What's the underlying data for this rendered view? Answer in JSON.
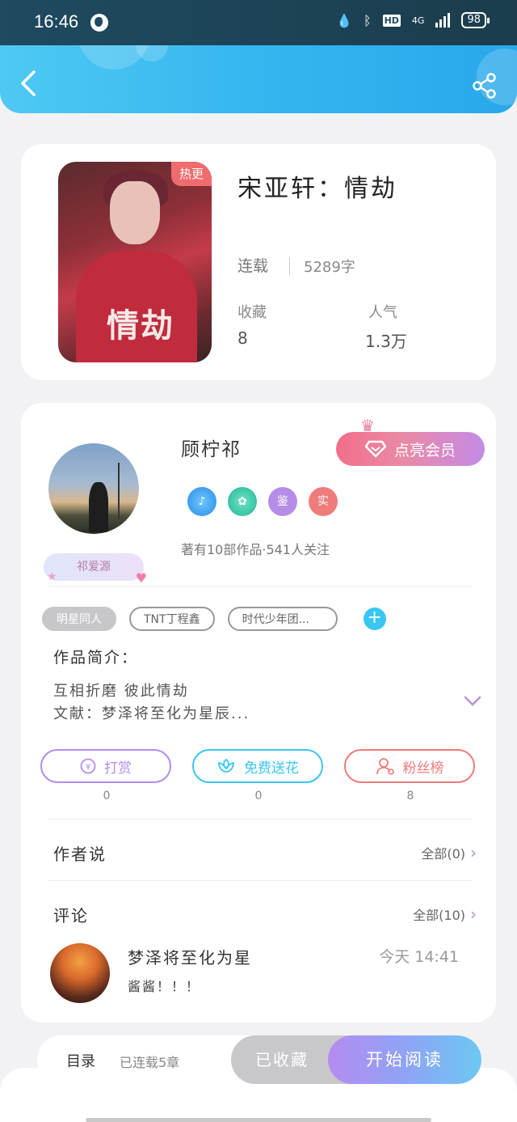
{
  "status_bar": {
    "time": "16:46",
    "hd": "HD",
    "network": "4G",
    "battery": "98"
  },
  "book": {
    "hot_badge": "热更",
    "cover_title": "情劫",
    "title": "宋亚轩：情劫",
    "status": "连载",
    "word_count": "5289字",
    "favorites_label": "收藏",
    "favorites_value": "8",
    "popularity_label": "人气",
    "popularity_value": "1.3万"
  },
  "author": {
    "name": "顾柠祁",
    "fan_tag": "祁爱源",
    "vip_button": "点亮会员",
    "badges": [
      "♪",
      "✿",
      "鉴",
      "实"
    ],
    "works_info": "著有10部作品·541人关注"
  },
  "tags": [
    "明星同人",
    "TNT丁程鑫",
    "时代少年团..."
  ],
  "intro": {
    "title": "作品简介：",
    "line1": "互相折磨 彼此情劫",
    "line2": "文献：梦泽将至化为星辰..."
  },
  "actions": [
    {
      "label": "打赏",
      "count": "0"
    },
    {
      "label": "免费送花",
      "count": "0"
    },
    {
      "label": "粉丝榜",
      "count": "8"
    }
  ],
  "author_says": {
    "title": "作者说",
    "more": "全部(0)"
  },
  "comments": {
    "title": "评论",
    "more": "全部(10)",
    "first": {
      "user": "梦泽将至化为星",
      "time": "今天 14:41",
      "text": "酱酱！！！"
    }
  },
  "bottom_bar": {
    "toc": "目录",
    "chapters": "已连载5章",
    "collected": "已收藏",
    "start_reading": "开始阅读"
  },
  "colors": {
    "header": "#35b6ef",
    "vip": "#f26f8a",
    "reward": "#b48cf0",
    "flower": "#38c6f2",
    "fans": "#f07b7b"
  }
}
